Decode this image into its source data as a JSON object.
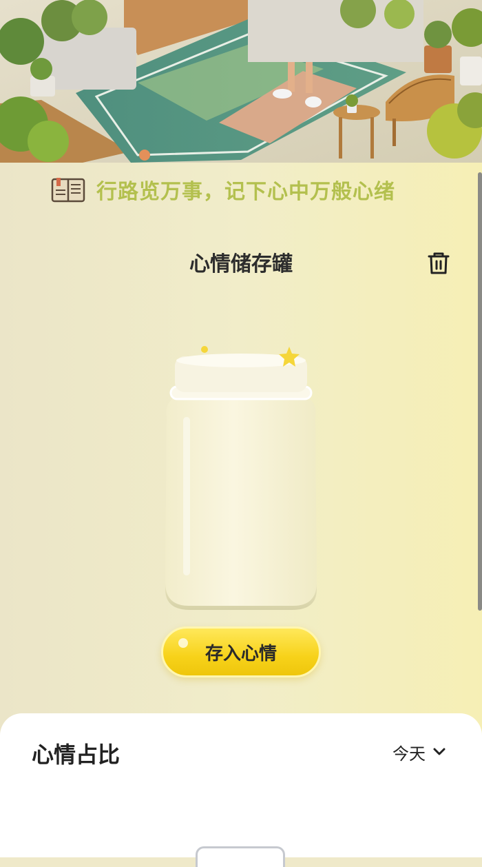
{
  "header": {
    "tagline": "行路览万事，记下心中万般心绪",
    "book_icon": "book-icon",
    "title": "心情储存罐",
    "trash_icon": "trash-icon"
  },
  "jar": {
    "name": "mood-jar"
  },
  "actions": {
    "save_label": "存入心情"
  },
  "stats_card": {
    "title": "心情占比",
    "period": "今天",
    "period_icon": "chevron-down-icon"
  },
  "colors": {
    "tagline": "#b3c04e",
    "button": "#f7d21a",
    "title": "#2c2c2c"
  }
}
